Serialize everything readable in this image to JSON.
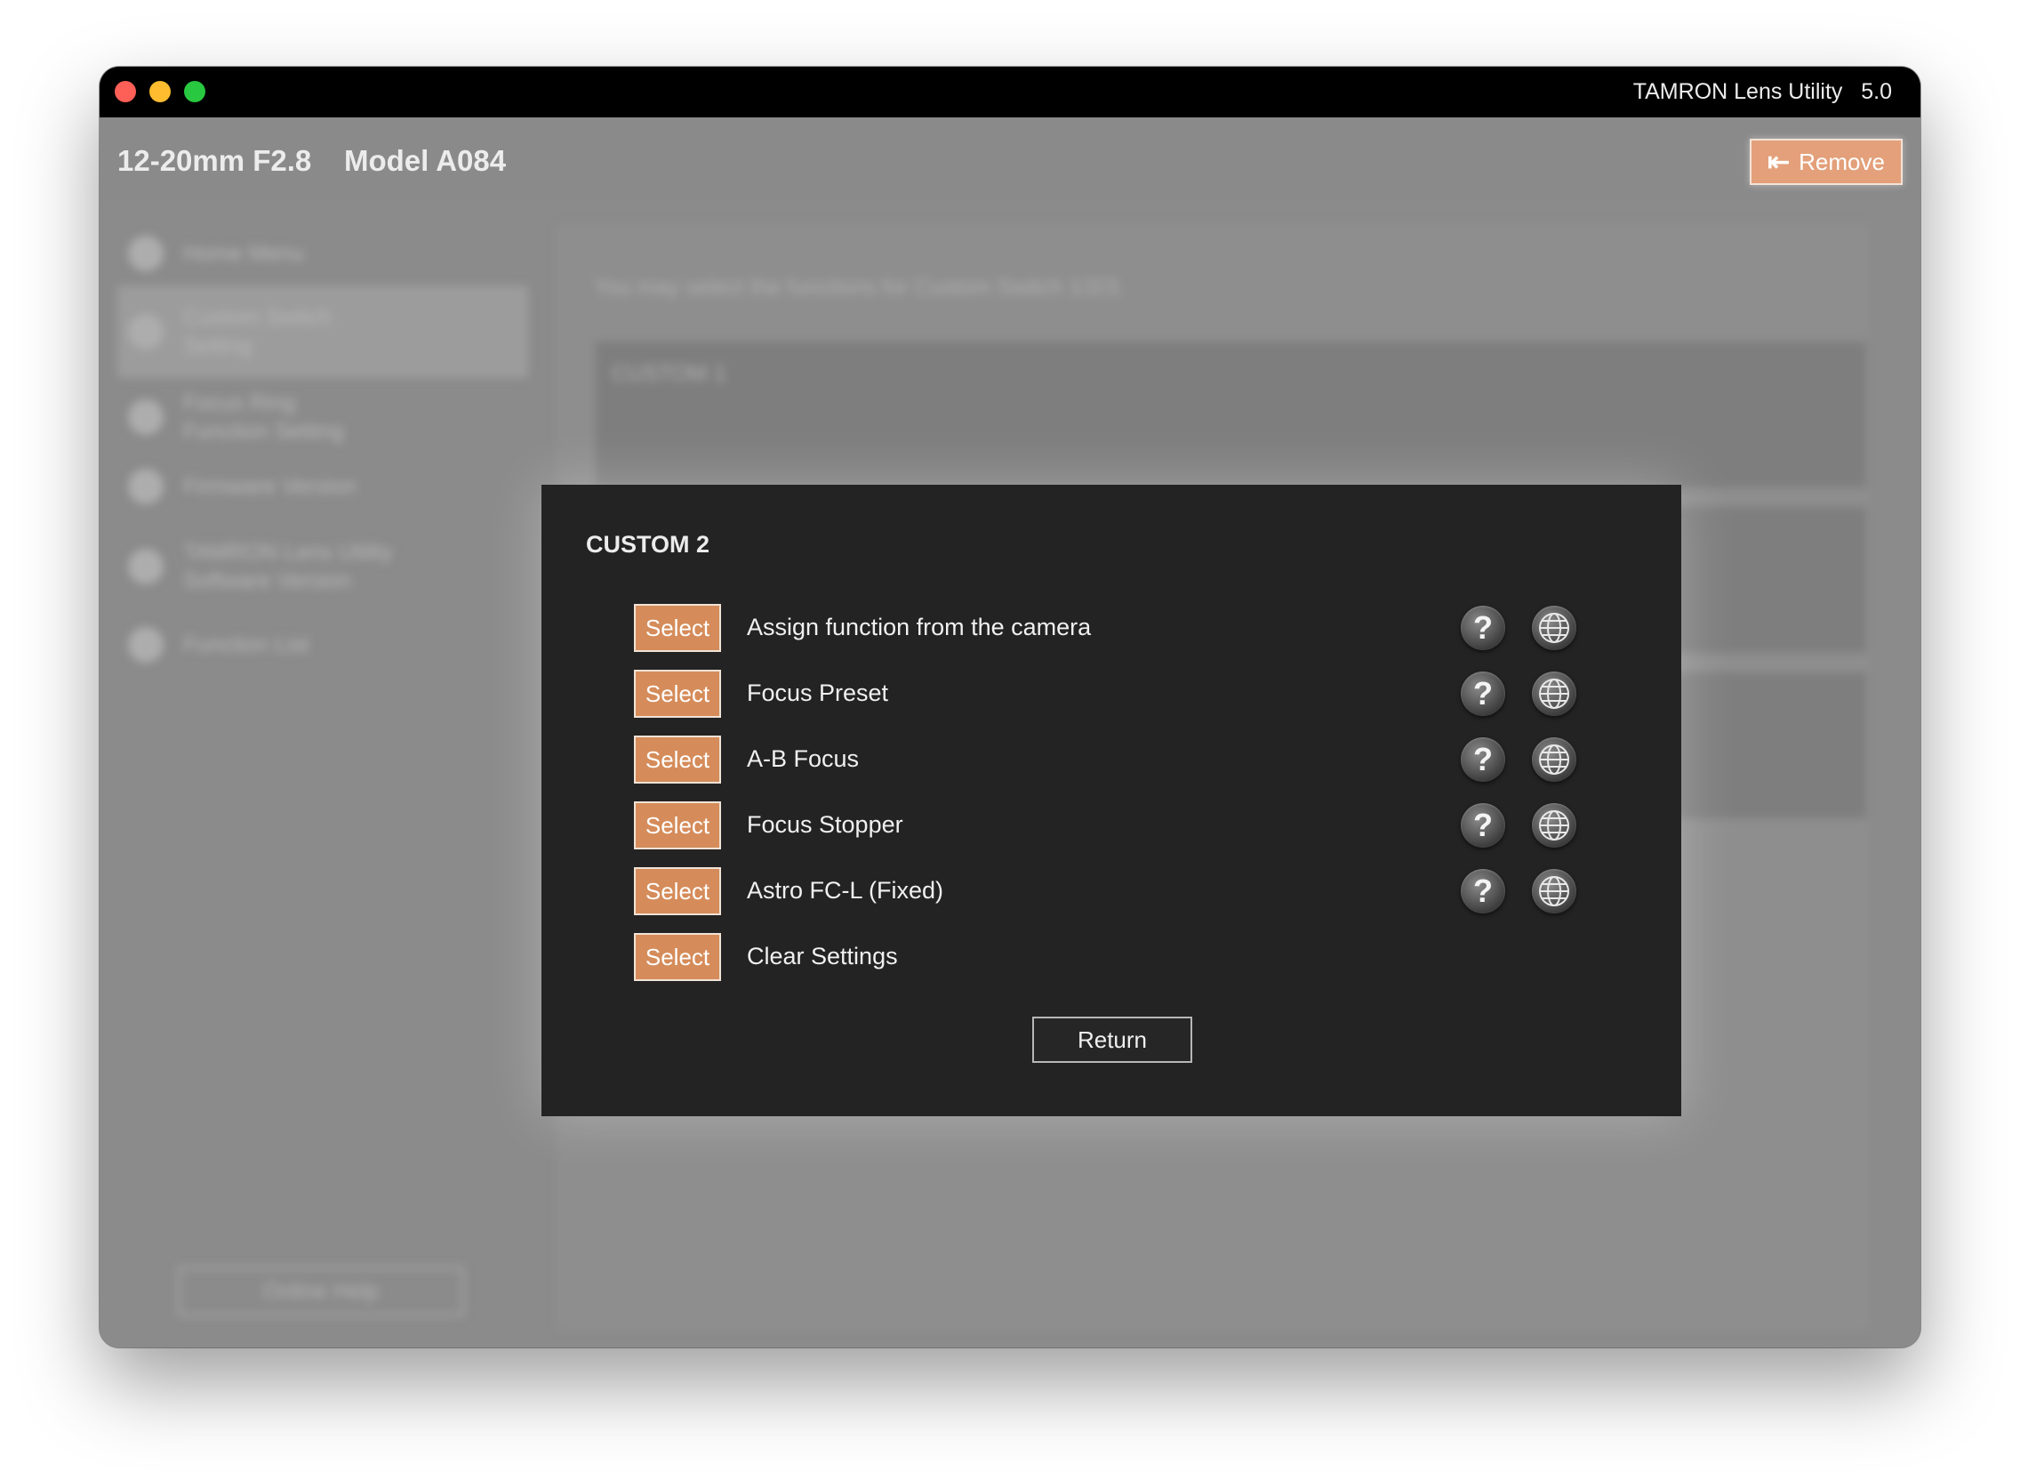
{
  "window": {
    "app_title": "TAMRON Lens Utility   5.0"
  },
  "header": {
    "lens_name": "12-20mm F2.8    Model A084",
    "remove_label": "Remove"
  },
  "sidebar": {
    "items": [
      {
        "label": "Home Menu",
        "icon": "home-icon"
      },
      {
        "label": "Custom Switch Setting",
        "icon": "switch-icon"
      },
      {
        "label": "Focus Ring Function Setting",
        "icon": "focus-ring-icon"
      },
      {
        "label": "Firmware Version",
        "icon": "firmware-icon"
      },
      {
        "label": "TAMRON Lens Utility Software Version",
        "icon": "info-icon"
      },
      {
        "label": "Function List",
        "icon": "list-icon"
      }
    ],
    "online_help": "Online Help"
  },
  "main": {
    "description": "You may select the functions for Custom Switch 1/2/3.",
    "card_label": "CUSTOM 1"
  },
  "dialog": {
    "title": "CUSTOM 2",
    "select_label": "Select",
    "options": [
      {
        "label": "Assign function from the camera"
      },
      {
        "label": "Focus Preset"
      },
      {
        "label": "A-B Focus"
      },
      {
        "label": "Focus Stopper"
      },
      {
        "label": "Astro FC-L (Fixed)"
      },
      {
        "label": "Clear Settings"
      }
    ],
    "help_glyph": "?",
    "return_label": "Return"
  }
}
